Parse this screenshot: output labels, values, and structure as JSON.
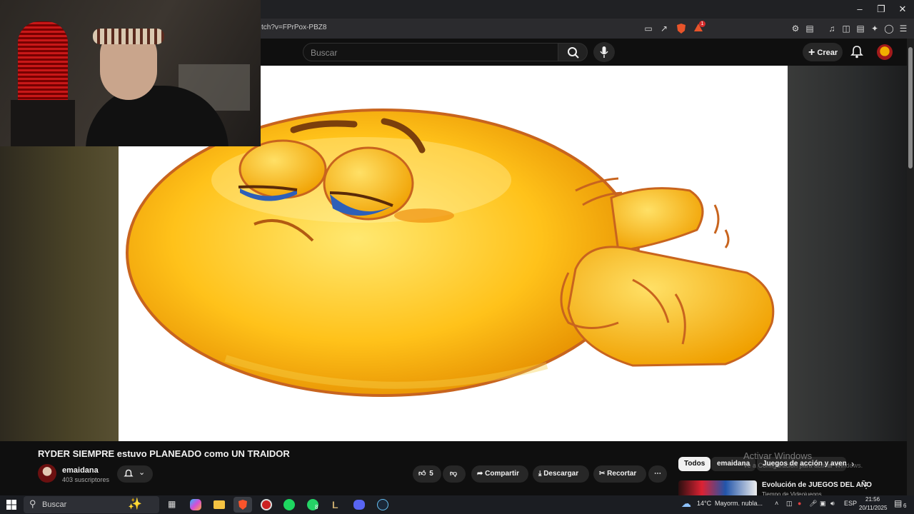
{
  "browser": {
    "url": "tch?v=FPrPox-PBZ8",
    "brave_badge": "1",
    "window_controls": [
      "minimize",
      "restore",
      "close"
    ]
  },
  "youtube": {
    "search_placeholder": "Buscar",
    "create_label": "Crear"
  },
  "video": {
    "title": "RYDER SIEMPRE estuvo PLANEADO como UN TRAIDOR",
    "channel_name": "emaidana",
    "subscribers": "403 suscriptores",
    "likes": "5",
    "share_label": "Compartir",
    "download_label": "Descargar",
    "clip_label": "Recortar"
  },
  "chips": [
    "Todos",
    "emaidana",
    "Juegos de acción y aventu"
  ],
  "recommended": {
    "title": "Evolución de JUEGOS DEL AÑO",
    "subtitle": "Tiempo de Videojuegos"
  },
  "watermark": {
    "line1": "Activar Windows",
    "line2": "Ve a Configuración para activar Windows."
  },
  "taskbar": {
    "search_placeholder": "Buscar",
    "weather": "14°C",
    "weather_desc": "Mayorm. nubla...",
    "language": "ESP",
    "time": "21:56",
    "date": "20/11/2025",
    "notifications": "6",
    "whatsapp_badge": "8"
  }
}
